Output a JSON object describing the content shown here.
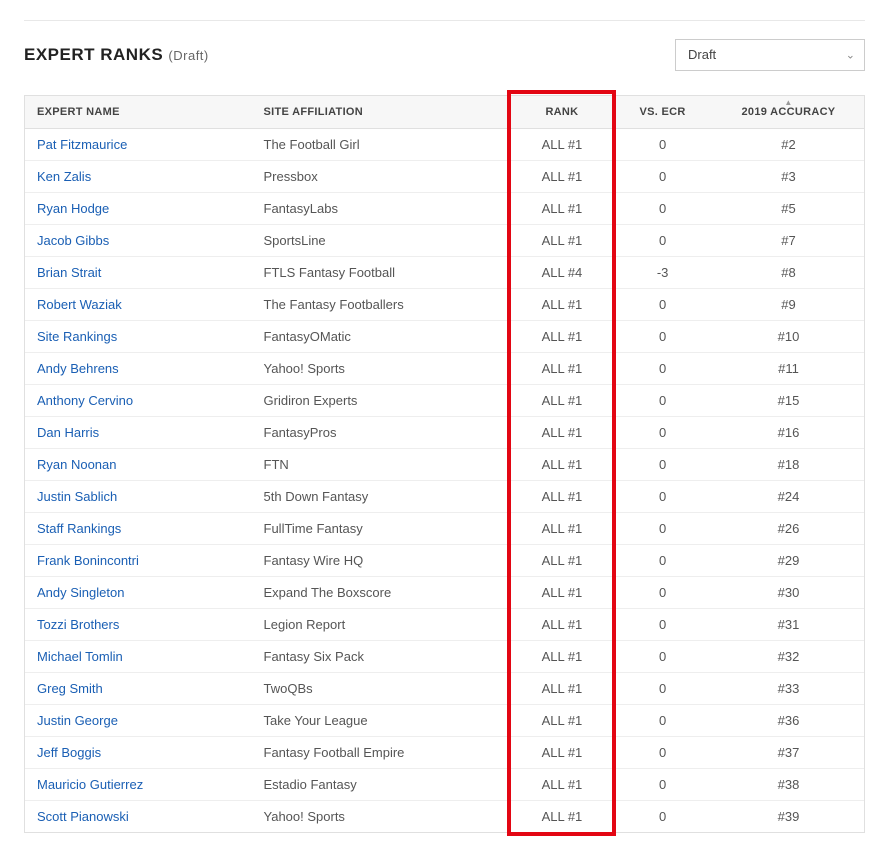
{
  "header": {
    "title": "EXPERT RANKS",
    "subtitle": "(Draft)"
  },
  "filter": {
    "selected": "Draft"
  },
  "columns": {
    "name": "EXPERT NAME",
    "site": "SITE AFFILIATION",
    "rank": "RANK",
    "vs": "VS. ECR",
    "acc": "2019 ACCURACY"
  },
  "rows": [
    {
      "name": "Pat Fitzmaurice",
      "site": "The Football Girl",
      "rank": "ALL #1",
      "vs": "0",
      "acc": "#2"
    },
    {
      "name": "Ken Zalis",
      "site": "Pressbox",
      "rank": "ALL #1",
      "vs": "0",
      "acc": "#3"
    },
    {
      "name": "Ryan Hodge",
      "site": "FantasyLabs",
      "rank": "ALL #1",
      "vs": "0",
      "acc": "#5"
    },
    {
      "name": "Jacob Gibbs",
      "site": "SportsLine",
      "rank": "ALL #1",
      "vs": "0",
      "acc": "#7"
    },
    {
      "name": "Brian Strait",
      "site": "FTLS Fantasy Football",
      "rank": "ALL #4",
      "vs": "-3",
      "acc": "#8"
    },
    {
      "name": "Robert Waziak",
      "site": "The Fantasy Footballers",
      "rank": "ALL #1",
      "vs": "0",
      "acc": "#9"
    },
    {
      "name": "Site Rankings",
      "site": "FantasyOMatic",
      "rank": "ALL #1",
      "vs": "0",
      "acc": "#10"
    },
    {
      "name": "Andy Behrens",
      "site": "Yahoo! Sports",
      "rank": "ALL #1",
      "vs": "0",
      "acc": "#11"
    },
    {
      "name": "Anthony Cervino",
      "site": "Gridiron Experts",
      "rank": "ALL #1",
      "vs": "0",
      "acc": "#15"
    },
    {
      "name": "Dan Harris",
      "site": "FantasyPros",
      "rank": "ALL #1",
      "vs": "0",
      "acc": "#16"
    },
    {
      "name": "Ryan Noonan",
      "site": "FTN",
      "rank": "ALL #1",
      "vs": "0",
      "acc": "#18"
    },
    {
      "name": "Justin Sablich",
      "site": "5th Down Fantasy",
      "rank": "ALL #1",
      "vs": "0",
      "acc": "#24"
    },
    {
      "name": "Staff Rankings",
      "site": "FullTime Fantasy",
      "rank": "ALL #1",
      "vs": "0",
      "acc": "#26"
    },
    {
      "name": "Frank Bonincontri",
      "site": "Fantasy Wire HQ",
      "rank": "ALL #1",
      "vs": "0",
      "acc": "#29"
    },
    {
      "name": "Andy Singleton",
      "site": "Expand The Boxscore",
      "rank": "ALL #1",
      "vs": "0",
      "acc": "#30"
    },
    {
      "name": "Tozzi Brothers",
      "site": "Legion Report",
      "rank": "ALL #1",
      "vs": "0",
      "acc": "#31"
    },
    {
      "name": "Michael Tomlin",
      "site": "Fantasy Six Pack",
      "rank": "ALL #1",
      "vs": "0",
      "acc": "#32"
    },
    {
      "name": "Greg Smith",
      "site": "TwoQBs",
      "rank": "ALL #1",
      "vs": "0",
      "acc": "#33"
    },
    {
      "name": "Justin George",
      "site": "Take Your League",
      "rank": "ALL #1",
      "vs": "0",
      "acc": "#36"
    },
    {
      "name": "Jeff Boggis",
      "site": "Fantasy Football Empire",
      "rank": "ALL #1",
      "vs": "0",
      "acc": "#37"
    },
    {
      "name": "Mauricio Gutierrez",
      "site": "Estadio Fantasy",
      "rank": "ALL #1",
      "vs": "0",
      "acc": "#38"
    },
    {
      "name": "Scott Pianowski",
      "site": "Yahoo! Sports",
      "rank": "ALL #1",
      "vs": "0",
      "acc": "#39"
    }
  ]
}
